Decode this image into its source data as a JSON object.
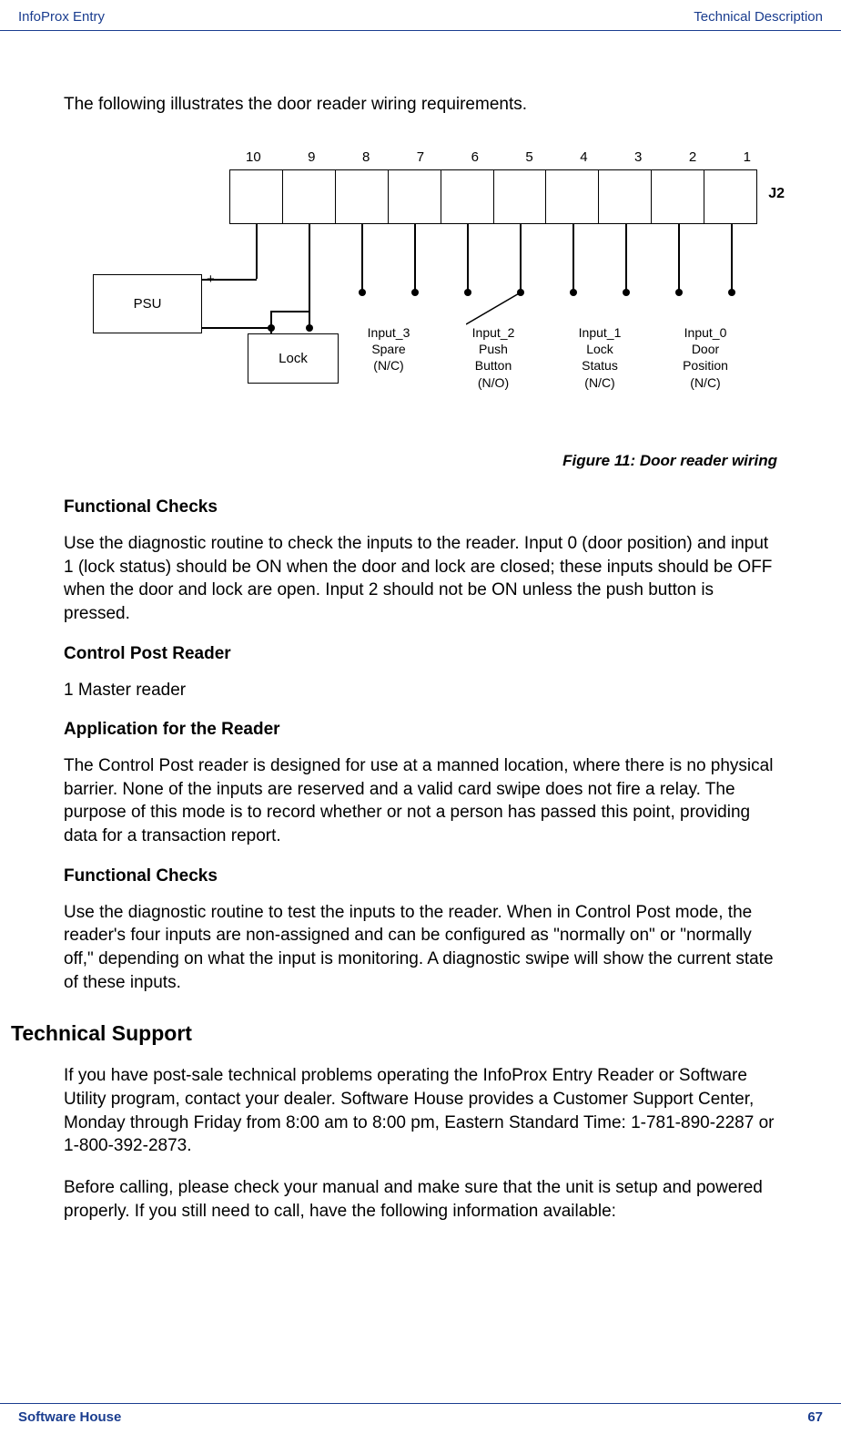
{
  "header": {
    "left": "InfoProx Entry",
    "right": "Technical Description"
  },
  "footer": {
    "left": "Software House",
    "right": "67"
  },
  "intro": "The following illustrates the door reader wiring requirements.",
  "diagram": {
    "terminal_numbers": [
      "10",
      "9",
      "8",
      "7",
      "6",
      "5",
      "4",
      "3",
      "2",
      "1"
    ],
    "j2": "J2",
    "psu": "PSU",
    "psu_plus": "+",
    "psu_minus": "-",
    "lock": "Lock",
    "inputs": {
      "input3_line1": "Input_3",
      "input3_line2": "Spare",
      "input3_line3": "(N/C)",
      "input2_line1": "Input_2",
      "input2_line2": "Push",
      "input2_line3": "Button",
      "input2_line4": "(N/O)",
      "input1_line1": "Input_1",
      "input1_line2": "Lock",
      "input1_line3": "Status",
      "input1_line4": "(N/C)",
      "input0_line1": "Input_0",
      "input0_line2": "Door",
      "input0_line3": "Position",
      "input0_line4": "(N/C)"
    }
  },
  "figure_caption": "Figure 11: Door reader wiring",
  "sections": {
    "fc1_heading": "Functional Checks",
    "fc1_body": "Use the diagnostic routine to check the inputs to the reader. Input 0 (door position) and input 1 (lock status) should be ON when the door and lock are closed; these inputs should be OFF when the door and lock are open. Input 2 should not be ON unless the push button is pressed.",
    "cpr_heading": "Control Post Reader",
    "cpr_body": "1 Master reader",
    "app_heading": "Application for the Reader",
    "app_body": "The Control Post reader is designed for use at a manned location, where there is no physical barrier. None of the inputs are reserved and a valid card swipe does not fire a relay. The purpose of this mode is to record whether or not a person has passed this point, providing data for a transaction report.",
    "fc2_heading": "Functional Checks",
    "fc2_body": "Use the diagnostic routine to test the inputs to the reader. When in Control Post mode, the reader's four inputs are non-assigned and can be configured as \"normally on\" or \"normally off,\" depending on what the input is monitoring. A diagnostic swipe will show the current state of these inputs.",
    "ts_heading": "Technical Support",
    "ts_body1": "If you have post-sale technical problems operating the InfoProx Entry Reader or Software Utility program, contact your dealer. Software House provides a Customer Support Center, Monday through Friday from 8:00 am to 8:00 pm, Eastern Standard Time: 1-781-890-2287 or 1-800-392-2873.",
    "ts_body2": "Before calling, please check your manual and make sure that the unit is setup and powered properly. If you still need to call, have the following information available:"
  }
}
